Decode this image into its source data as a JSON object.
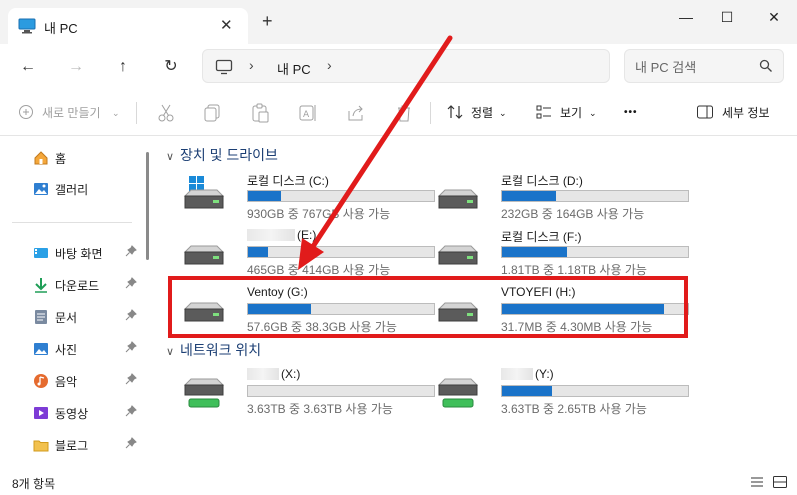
{
  "tab": {
    "title": "내 PC",
    "close": "✕",
    "new": "+"
  },
  "window": {
    "minimize": "—",
    "maximize": "☐",
    "close": "✕"
  },
  "nav": {
    "back": "←",
    "forward": "→",
    "up": "↑",
    "refresh": "↻",
    "address_label": "내 PC",
    "address_sep": "›",
    "search_placeholder": "내 PC 검색"
  },
  "commandbar": {
    "new": "새로 만들기",
    "sort": "정렬",
    "view": "보기",
    "more": "•••",
    "details": "세부 정보"
  },
  "sidebar": {
    "items": [
      {
        "label": "홈",
        "icon": "home-icon"
      },
      {
        "label": "갤러리",
        "icon": "gallery-icon"
      },
      {
        "label": "바탕 화면",
        "icon": "desktop-icon",
        "pinned": true
      },
      {
        "label": "다운로드",
        "icon": "download-icon",
        "pinned": true
      },
      {
        "label": "문서",
        "icon": "document-icon",
        "pinned": true
      },
      {
        "label": "사진",
        "icon": "picture-icon",
        "pinned": true
      },
      {
        "label": "음악",
        "icon": "music-icon",
        "pinned": true
      },
      {
        "label": "동영상",
        "icon": "video-icon",
        "pinned": true
      },
      {
        "label": "블로그",
        "icon": "folder-icon",
        "pinned": true
      }
    ]
  },
  "groups": {
    "devices": "장치 및 드라이브",
    "network": "네트워크 위치"
  },
  "drives": [
    {
      "name": "로컬 디스크 (C:)",
      "info": "930GB 중 767GB 사용 가능",
      "used_fraction": 0.18,
      "type": "local-windows",
      "blurred_name": false
    },
    {
      "name": "로컬 디스크 (D:)",
      "info": "232GB 중 164GB 사용 가능",
      "used_fraction": 0.29,
      "type": "local",
      "blurred_name": false
    },
    {
      "name": "(E:)",
      "info": "465GB 중 414GB 사용 가능",
      "used_fraction": 0.11,
      "type": "local",
      "blurred_name": true
    },
    {
      "name": "로컬 디스크 (F:)",
      "info": "1.81TB 중 1.18TB 사용 가능",
      "used_fraction": 0.35,
      "type": "local",
      "blurred_name": false
    },
    {
      "name": "Ventoy (G:)",
      "info": "57.6GB 중 38.3GB 사용 가능",
      "used_fraction": 0.34,
      "type": "local",
      "blurred_name": false
    },
    {
      "name": "VTOYEFI (H:)",
      "info": "31.7MB 중 4.30MB 사용 가능",
      "used_fraction": 0.87,
      "type": "local",
      "blurred_name": false
    }
  ],
  "network_drives": [
    {
      "name": "(X:)",
      "info": "3.63TB 중 3.63TB 사용 가능",
      "used_fraction": 0.0,
      "blurred_name": true
    },
    {
      "name": "(Y:)",
      "info": "3.63TB 중 2.65TB 사용 가능",
      "used_fraction": 0.27,
      "blurred_name": true
    }
  ],
  "status": {
    "count": "8개 항목"
  },
  "colors": {
    "accent": "#1a73c9",
    "highlight": "#e11b1b",
    "group_header": "#1c3f74"
  }
}
